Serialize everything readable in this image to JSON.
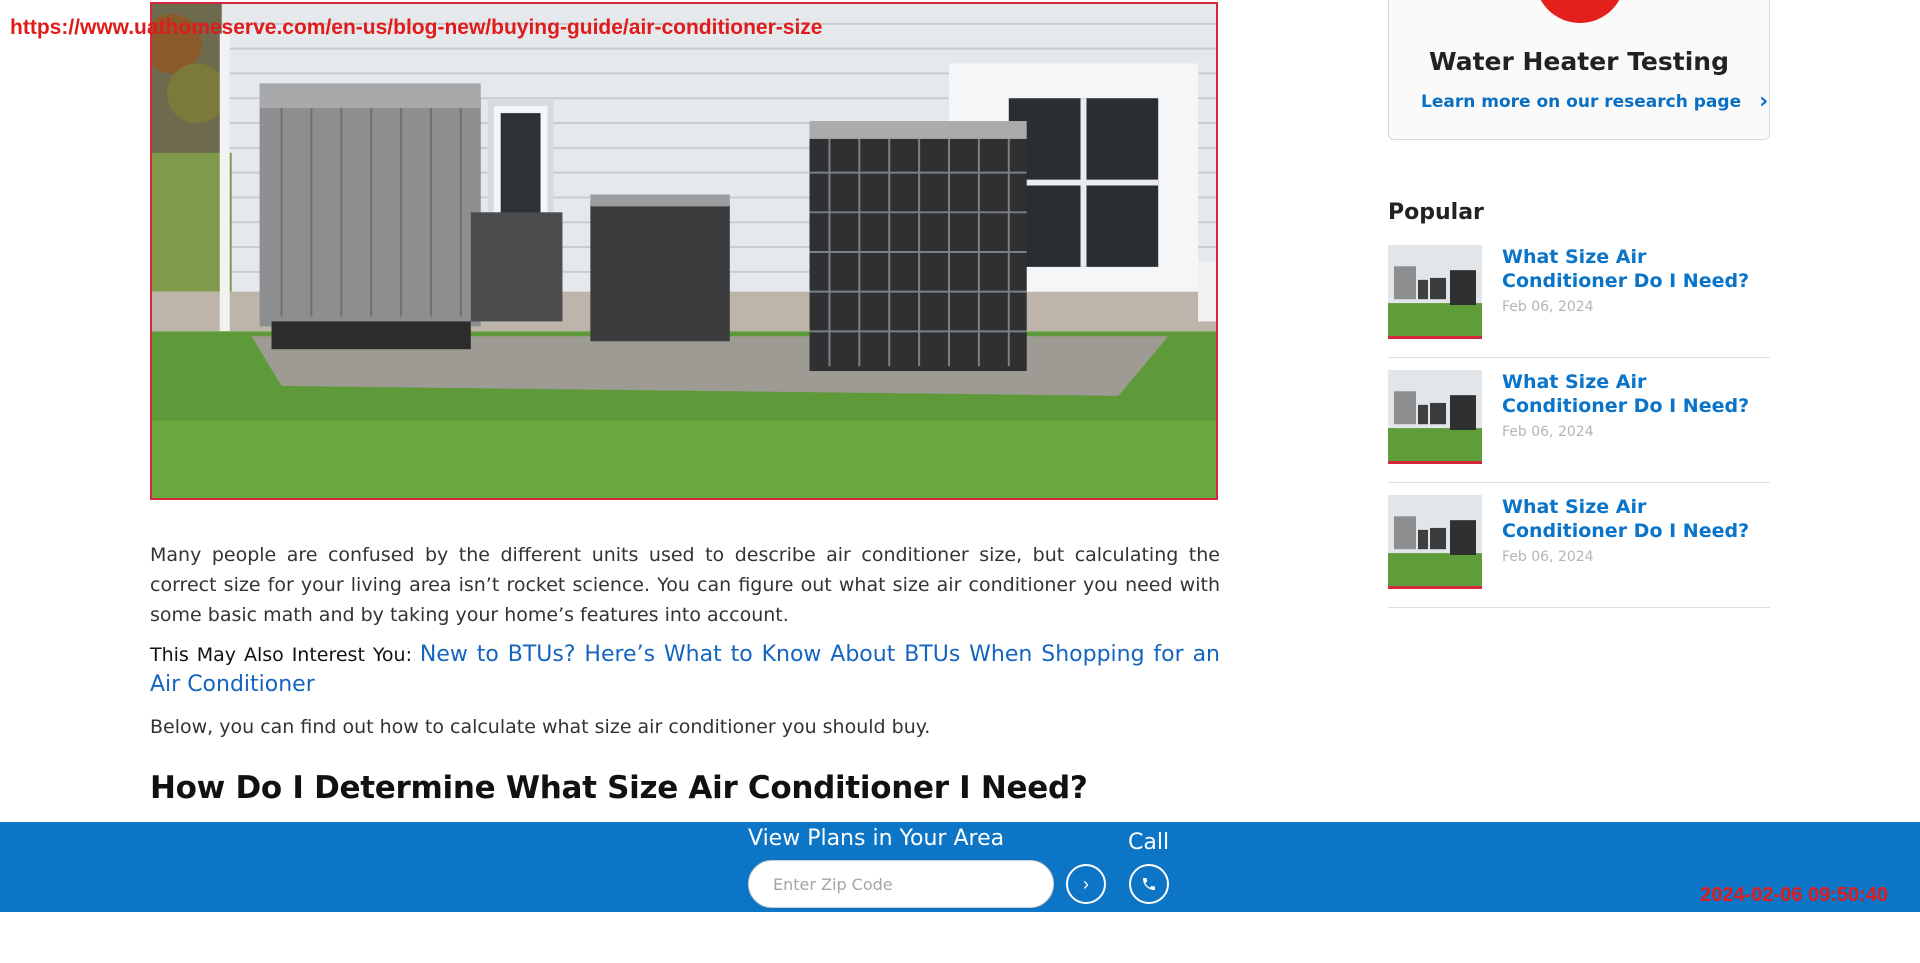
{
  "overlay": {
    "url": "https://www.uathomeserve.com/en-us/blog-new/buying-guide/air-conditioner-size",
    "timestamp": "2024-02-06 09:50:40"
  },
  "hero": {
    "icon": "air-conditioner-units-photo"
  },
  "article": {
    "paragraph_1": "Many people are confused by the different units used to describe air conditioner size, but calculating the correct size for your living area isn’t rocket science. You can figure out what size air conditioner you need with some basic math and by taking your home’s features into account.",
    "interest_lead": "This May Also Interest You:",
    "interest_link": "New to BTUs? Here’s What to Know About BTUs When Shopping for an Air Conditioner",
    "paragraph_2": "Below, you can find out how to calculate what size air conditioner you should buy.",
    "heading": "How Do I Determine What Size Air Conditioner I Need?"
  },
  "sidebar": {
    "promo": {
      "title": "Water Heater Testing",
      "link": "Learn more on our research page"
    },
    "popular_title": "Popular",
    "popular_items": [
      {
        "title": "What Size Air Conditioner Do I Need?",
        "date": "Feb 06, 2024"
      },
      {
        "title": "What Size Air Conditioner Do I Need?",
        "date": "Feb 06, 2024"
      },
      {
        "title": "What Size Air Conditioner Do I Need?",
        "date": "Feb 06, 2024"
      }
    ]
  },
  "bottom_bar": {
    "plans_label": "View Plans in Your Area",
    "zip_placeholder": "Enter Zip Code",
    "call_label": "Call"
  },
  "colors": {
    "accent_blue": "#0c75c5",
    "link_blue": "#0a74c8",
    "brand_red": "#e3201b"
  }
}
